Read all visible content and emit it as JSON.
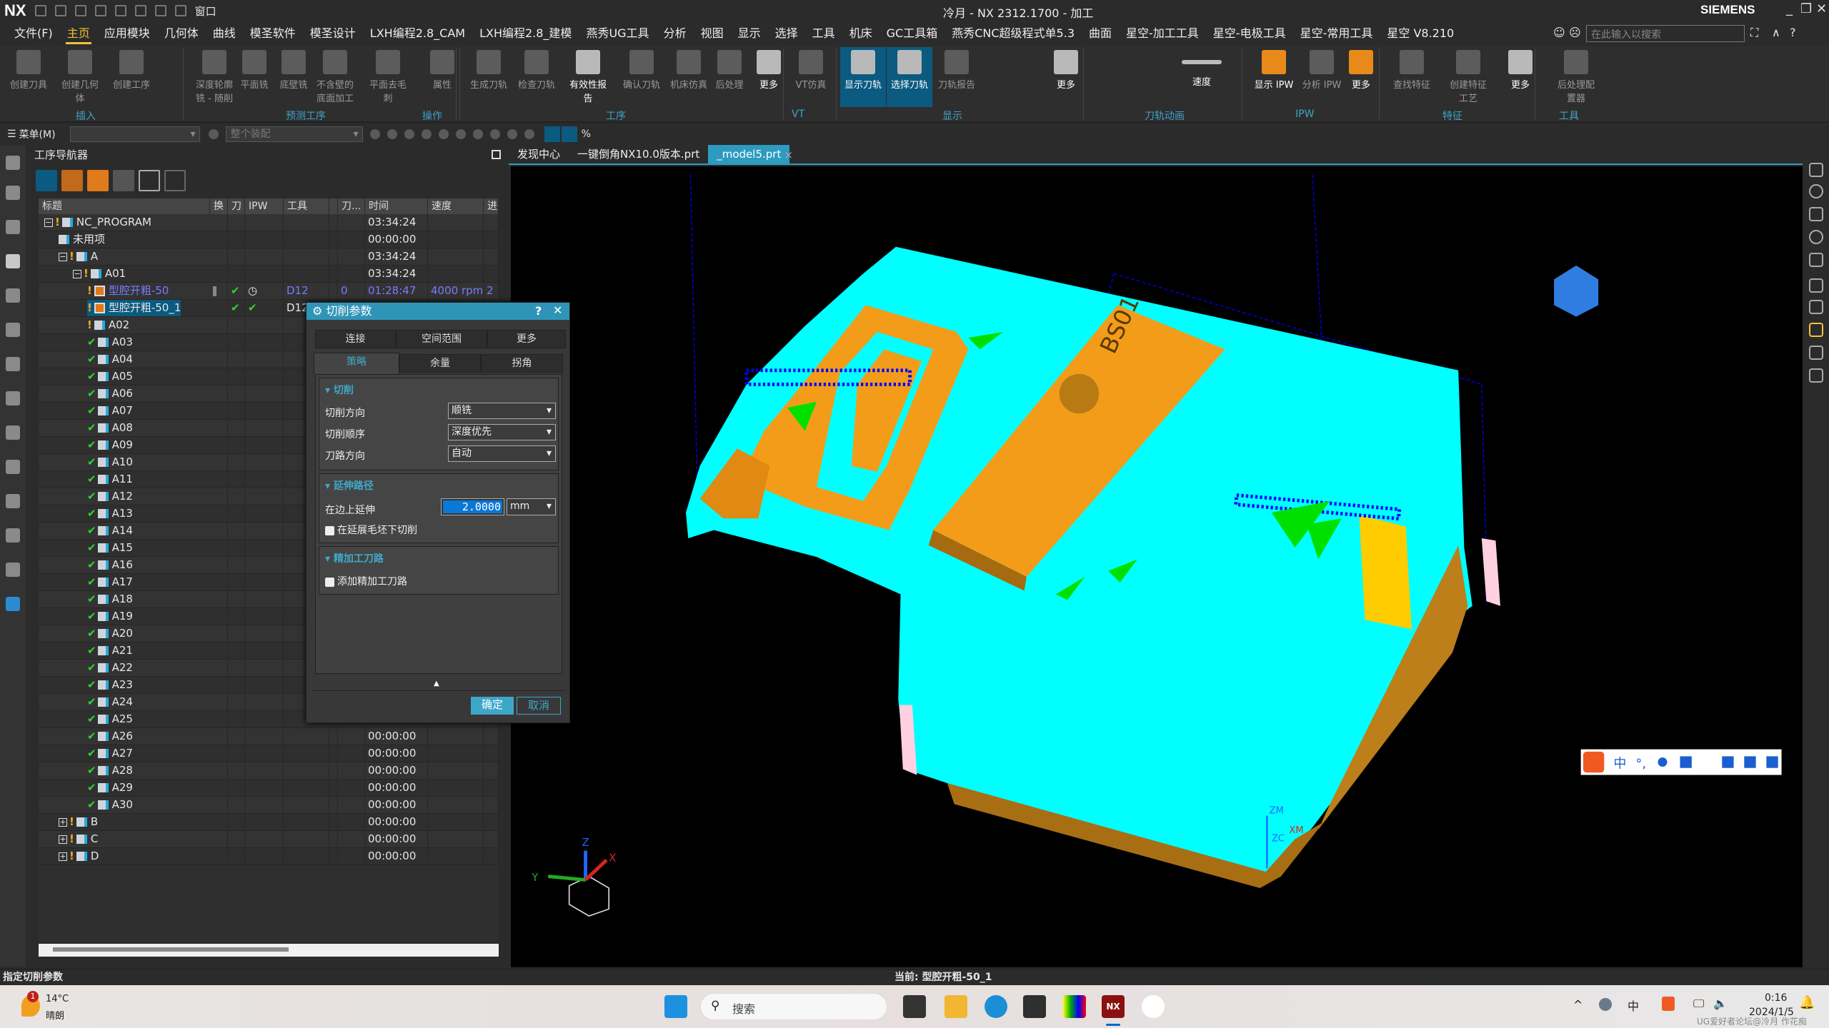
{
  "app": {
    "logo": "NX",
    "title": "冷月 - NX 2312.1700 - 加工",
    "brand": "SIEMENS",
    "quick_window": "窗口"
  },
  "menu": [
    "文件(F)",
    "主页",
    "应用模块",
    "几何体",
    "曲线",
    "模圣软件",
    "模圣设计",
    "LXH编程2.8_CAM",
    "LXH编程2.8_建模",
    "燕秀UG工具",
    "分析",
    "视图",
    "显示",
    "选择",
    "工具",
    "机床",
    "GC工具箱",
    "燕秀CNC超级程式单5.3",
    "曲面",
    "星空-加工工具",
    "星空-电极工具",
    "星空-常用工具",
    "星空 V8.210"
  ],
  "menu_active": "主页",
  "search_placeholder": "在此输入以搜索",
  "ribbon": {
    "buttons": [
      {
        "label": "创建刀具",
        "enabled": false
      },
      {
        "label": "创建几何体",
        "enabled": false
      },
      {
        "label": "创建工序",
        "enabled": false
      },
      {
        "label": "深度轮廓铣 - 随削",
        "enabled": false
      },
      {
        "label": "平面铣",
        "enabled": false
      },
      {
        "label": "底壁铣",
        "enabled": false
      },
      {
        "label": "不含壁的底面加工",
        "enabled": false
      },
      {
        "label": "平面去毛刺",
        "enabled": false
      },
      {
        "label": "属性",
        "enabled": false
      },
      {
        "label": "生成刀轨",
        "enabled": false
      },
      {
        "label": "检查刀轨",
        "enabled": false
      },
      {
        "label": "有效性报告",
        "enabled": true
      },
      {
        "label": "确认刀轨",
        "enabled": false
      },
      {
        "label": "机床仿真",
        "enabled": false
      },
      {
        "label": "后处理",
        "enabled": false
      },
      {
        "label": "更多",
        "enabled": true
      },
      {
        "label": "VT仿真",
        "enabled": false
      },
      {
        "label": "显示刀轨",
        "enabled": true,
        "selected": true
      },
      {
        "label": "选择刀轨",
        "enabled": true,
        "selected": true
      },
      {
        "label": "刀轨报告",
        "enabled": false
      },
      {
        "label": "更多",
        "enabled": true
      },
      {
        "label": "速度",
        "enabled": true
      },
      {
        "label": "显示 IPW",
        "enabled": true,
        "icon": "orange"
      },
      {
        "label": "分析 IPW",
        "enabled": false
      },
      {
        "label": "更多",
        "enabled": true,
        "icon": "orange"
      },
      {
        "label": "查找特征",
        "enabled": false
      },
      {
        "label": "创建特征工艺",
        "enabled": false
      },
      {
        "label": "更多",
        "enabled": true
      },
      {
        "label": "后处理配置器",
        "enabled": false
      }
    ],
    "groups": [
      "插入",
      "预测工序",
      "操作",
      "工序",
      "VT",
      "显示",
      "刀轨动画",
      "IPW",
      "特征",
      "工具"
    ]
  },
  "toolbar2": {
    "menu_label": "菜单(M)",
    "filter_value": "",
    "scope_value": "整个装配"
  },
  "navigator": {
    "title": "工序导航器",
    "columns": [
      "标题",
      "换",
      "刀",
      "IPW",
      "工具",
      "",
      "刀...",
      "时间",
      "速度",
      "进"
    ],
    "rows": [
      {
        "label": "NC_PROGRAM",
        "level": 0,
        "expand": "-",
        "warn": true,
        "icon": "folder",
        "time": "03:34:24"
      },
      {
        "label": "未用项",
        "level": 1,
        "icon": "folder",
        "time": "00:00:00"
      },
      {
        "label": "A",
        "level": 1,
        "expand": "-",
        "warn": true,
        "icon": "folder",
        "time": "03:34:24"
      },
      {
        "label": "A01",
        "level": 2,
        "expand": "-",
        "warn": true,
        "icon": "folder",
        "time": "03:34:24"
      },
      {
        "label": "型腔开粗-50",
        "level": 3,
        "warn": true,
        "icon": "op",
        "blue": true,
        "toolpath": "check",
        "ipw": "clock",
        "tool": "D12",
        "tool_no": "0",
        "time": "01:28:47",
        "speed": "4000 rpm",
        "feed": "2"
      },
      {
        "label": "型腔开粗-50_1",
        "level": 3,
        "warn": true,
        "icon": "op",
        "selected": true,
        "toolpath": "check",
        "ipw": "check",
        "tool": "D12"
      },
      {
        "label": "A02",
        "level": 3,
        "warn": true,
        "icon": "folder"
      },
      {
        "label": "A03",
        "level": 3,
        "check": true,
        "icon": "folder"
      },
      {
        "label": "A04",
        "level": 3,
        "check": true,
        "icon": "folder"
      },
      {
        "label": "A05",
        "level": 3,
        "check": true,
        "icon": "folder"
      },
      {
        "label": "A06",
        "level": 3,
        "check": true,
        "icon": "folder"
      },
      {
        "label": "A07",
        "level": 3,
        "check": true,
        "icon": "folder"
      },
      {
        "label": "A08",
        "level": 3,
        "check": true,
        "icon": "folder"
      },
      {
        "label": "A09",
        "level": 3,
        "check": true,
        "icon": "folder"
      },
      {
        "label": "A10",
        "level": 3,
        "check": true,
        "icon": "folder"
      },
      {
        "label": "A11",
        "level": 3,
        "check": true,
        "icon": "folder"
      },
      {
        "label": "A12",
        "level": 3,
        "check": true,
        "icon": "folder"
      },
      {
        "label": "A13",
        "level": 3,
        "check": true,
        "icon": "folder"
      },
      {
        "label": "A14",
        "level": 3,
        "check": true,
        "icon": "folder"
      },
      {
        "label": "A15",
        "level": 3,
        "check": true,
        "icon": "folder"
      },
      {
        "label": "A16",
        "level": 3,
        "check": true,
        "icon": "folder"
      },
      {
        "label": "A17",
        "level": 3,
        "check": true,
        "icon": "folder"
      },
      {
        "label": "A18",
        "level": 3,
        "check": true,
        "icon": "folder"
      },
      {
        "label": "A19",
        "level": 3,
        "check": true,
        "icon": "folder"
      },
      {
        "label": "A20",
        "level": 3,
        "check": true,
        "icon": "folder"
      },
      {
        "label": "A21",
        "level": 3,
        "check": true,
        "icon": "folder"
      },
      {
        "label": "A22",
        "level": 3,
        "check": true,
        "icon": "folder"
      },
      {
        "label": "A23",
        "level": 3,
        "check": true,
        "icon": "folder"
      },
      {
        "label": "A24",
        "level": 3,
        "check": true,
        "icon": "folder"
      },
      {
        "label": "A25",
        "level": 3,
        "check": true,
        "icon": "folder"
      },
      {
        "label": "A26",
        "level": 3,
        "check": true,
        "icon": "folder",
        "time": "00:00:00"
      },
      {
        "label": "A27",
        "level": 3,
        "check": true,
        "icon": "folder",
        "time": "00:00:00"
      },
      {
        "label": "A28",
        "level": 3,
        "check": true,
        "icon": "folder",
        "time": "00:00:00"
      },
      {
        "label": "A29",
        "level": 3,
        "check": true,
        "icon": "folder",
        "time": "00:00:00"
      },
      {
        "label": "A30",
        "level": 3,
        "check": true,
        "icon": "folder",
        "time": "00:00:00"
      },
      {
        "label": "B",
        "level": 1,
        "expand": "+",
        "warn": true,
        "icon": "folder",
        "time": "00:00:00"
      },
      {
        "label": "C",
        "level": 1,
        "expand": "+",
        "warn": true,
        "icon": "folder",
        "time": "00:00:00"
      },
      {
        "label": "D",
        "level": 1,
        "expand": "+",
        "warn": true,
        "icon": "folder",
        "time": "00:00:00"
      }
    ]
  },
  "doc_tabs": [
    {
      "label": "发现中心"
    },
    {
      "label": "一键倒角NX10.0版本.prt"
    },
    {
      "label": "_model5.prt",
      "active": true
    }
  ],
  "viewport": {
    "part_text": "BS01",
    "triad": {
      "x": "X",
      "y": "Y",
      "z": "Z"
    },
    "csys": {
      "zm": "ZM",
      "xm": "XM",
      "zc": "ZC"
    },
    "ime": [
      "中",
      "°,"
    ]
  },
  "dialog": {
    "title": "切削参数",
    "tabs_row1": [
      "连接",
      "空间范围",
      "更多"
    ],
    "tabs_row2": [
      "策略",
      "余量",
      "拐角"
    ],
    "active_tab": "策略",
    "group_cut": {
      "title": "切削",
      "fields": [
        {
          "label": "切削方向",
          "value": "顺铣"
        },
        {
          "label": "切削顺序",
          "value": "深度优先"
        },
        {
          "label": "刀路方向",
          "value": "自动"
        }
      ]
    },
    "group_extend": {
      "title": "延伸路径",
      "extend_label": "在边上延伸",
      "extend_value": "2.0000",
      "unit": "mm",
      "checkbox_label": "在延展毛坯下切削",
      "checked": false
    },
    "group_finish": {
      "title": "精加工刀路",
      "checkbox_label": "添加精加工刀路",
      "checked": false
    },
    "ok": "确定",
    "cancel": "取消"
  },
  "status": {
    "left": "指定切削参数",
    "center": "当前: 型腔开粗-50_1"
  },
  "taskbar": {
    "weather_temp": "14°C",
    "weather_text": "晴朗",
    "weather_badge": "1",
    "search": "搜索",
    "time": "0:16",
    "date": "2024/1/5",
    "ime": "中",
    "watermark": "UG爱好者论坛@冷月 作花痴"
  },
  "colors": {
    "accent": "#2d9bc0",
    "selected_row": "#0b5a80",
    "part_cyan": "#00ffff",
    "part_orange": "#f39c1a",
    "toolpath_blue": "#0000ff",
    "warn": "#f5a623",
    "check": "#2fd62f"
  }
}
